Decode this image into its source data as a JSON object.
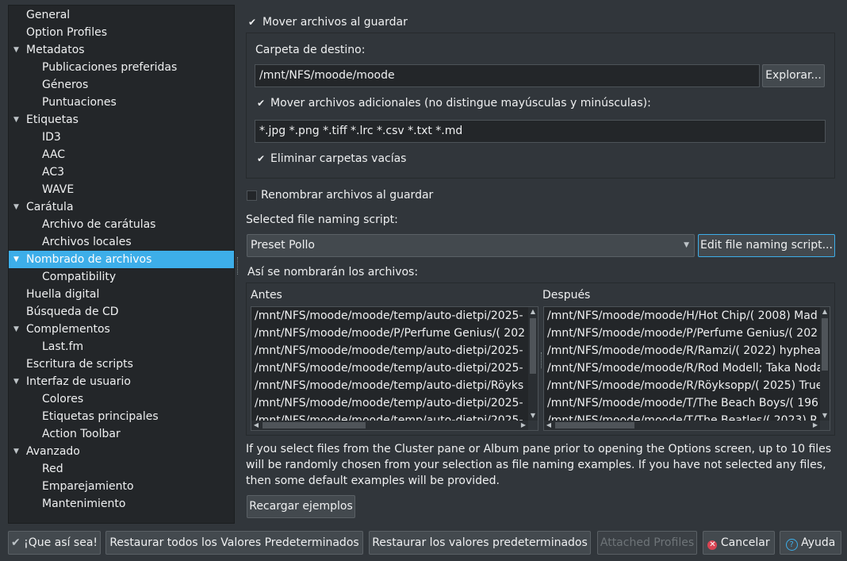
{
  "sidebar": {
    "items": [
      {
        "label": "General"
      },
      {
        "label": "Option Profiles"
      },
      {
        "label": "Metadatos"
      },
      {
        "label": "Publicaciones preferidas"
      },
      {
        "label": "Géneros"
      },
      {
        "label": "Puntuaciones"
      },
      {
        "label": "Etiquetas"
      },
      {
        "label": "ID3"
      },
      {
        "label": "AAC"
      },
      {
        "label": "AC3"
      },
      {
        "label": "WAVE"
      },
      {
        "label": "Carátula"
      },
      {
        "label": "Archivo de carátulas"
      },
      {
        "label": "Archivos locales"
      },
      {
        "label": "Nombrado de archivos"
      },
      {
        "label": "Compatibility"
      },
      {
        "label": "Huella digital"
      },
      {
        "label": "Búsqueda de CD"
      },
      {
        "label": "Complementos"
      },
      {
        "label": "Last.fm"
      },
      {
        "label": "Escritura de scripts"
      },
      {
        "label": "Interfaz de usuario"
      },
      {
        "label": "Colores"
      },
      {
        "label": "Etiquetas principales"
      },
      {
        "label": "Action Toolbar"
      },
      {
        "label": "Avanzado"
      },
      {
        "label": "Red"
      },
      {
        "label": "Emparejamiento"
      },
      {
        "label": "Mantenimiento"
      }
    ],
    "selected": "Nombrado de archivos"
  },
  "move": {
    "label": "Mover archivos al guardar",
    "checked": true,
    "dest_label": "Carpeta de destino:",
    "dest_value": "/mnt/NFS/moode/moode",
    "browse_label": "Explorar...",
    "extra_label": "Mover archivos adicionales (no distingue mayúsculas y minúsculas):",
    "extra_value": "*.jpg *.png *.tiff *.lrc *.csv *.txt *.md",
    "delete_empty_label": "Eliminar carpetas vacías"
  },
  "rename": {
    "label": "Renombrar archivos al guardar",
    "checked": false
  },
  "script": {
    "label": "Selected file naming script:",
    "selected": "Preset Pollo",
    "edit_label": "Edit file naming script..."
  },
  "examples": {
    "title": "Así se nombrarán los archivos:",
    "before_header": "Antes",
    "after_header": "Después",
    "before": [
      "/mnt/NFS/moode/moode/temp/auto-dietpi/2025-",
      "/mnt/NFS/moode/moode/P/Perfume Genius/( 202",
      "/mnt/NFS/moode/moode/temp/auto-dietpi/2025-",
      "/mnt/NFS/moode/moode/temp/auto-dietpi/2025-",
      "/mnt/NFS/moode/moode/temp/auto-dietpi/Röyks",
      "/mnt/NFS/moode/moode/temp/auto-dietpi/2025-",
      "/mnt/NFS/moode/moode/temp/auto-dietpi/2025-"
    ],
    "after": [
      "/mnt/NFS/moode/moode/H/Hot Chip/( 2008) Mad",
      "/mnt/NFS/moode/moode/P/Perfume Genius/( 202",
      "/mnt/NFS/moode/moode/R/Ramzi/( 2022) hyphea",
      "/mnt/NFS/moode/moode/R/Rod Modell; Taka Noda",
      "/mnt/NFS/moode/moode/R/Röyksopp/( 2025) True",
      "/mnt/NFS/moode/moode/T/The Beach Boys/( 196",
      "/mnt/NFS/moode/moode/T/The Beatles/( 2023) R"
    ],
    "note_lines": [
      "If you select files from the Cluster pane or Album pane prior to opening the Options screen, up to 10 files",
      "will be randomly chosen from your selection as file naming examples.  If you have not selected any files,",
      "then some default examples will be provided."
    ],
    "reload_label": "Recargar ejemplos"
  },
  "footer": {
    "ok_label": "¡Que así sea!",
    "restore_all_label": "Restaurar todos los Valores Predeterminados",
    "restore_label": "Restaurar los valores predeterminados",
    "attached_label": "Attached Profiles",
    "cancel_label": "Cancelar",
    "help_label": "Ayuda"
  },
  "colors": {
    "accent": "#3daee9",
    "background": "#31363b",
    "field": "#232629",
    "cancel_icon": "#da4453"
  }
}
